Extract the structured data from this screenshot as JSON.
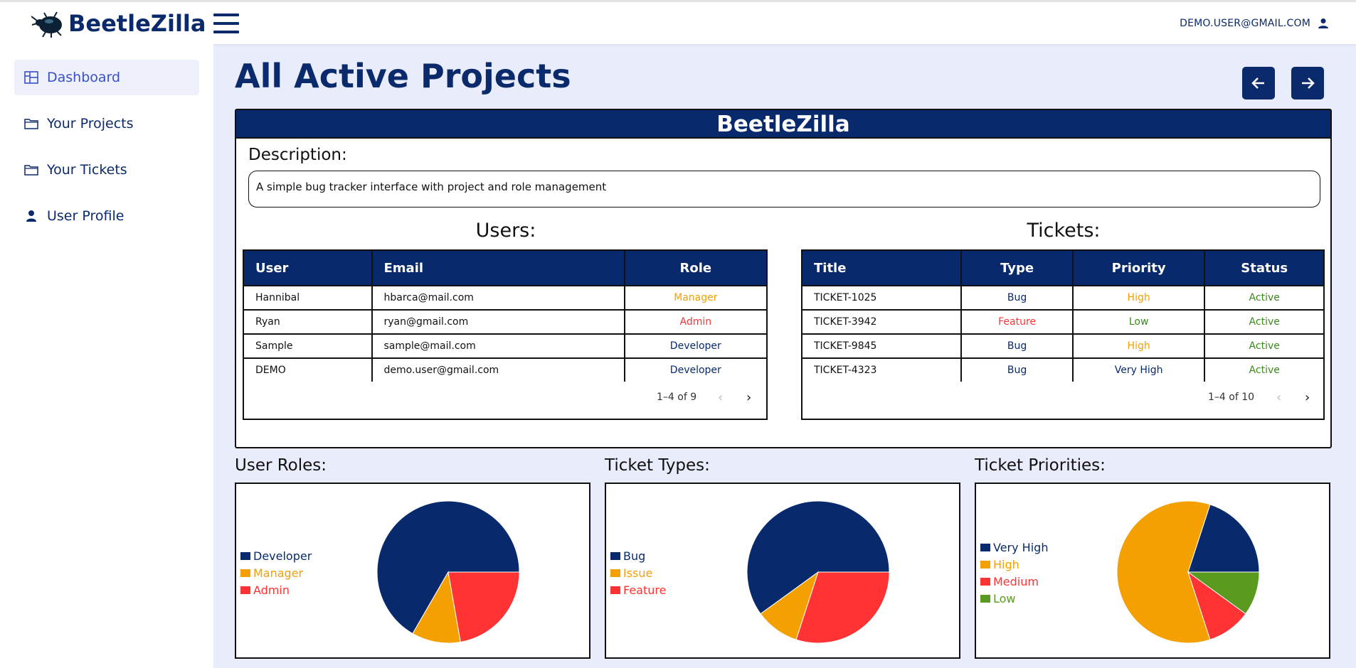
{
  "app": {
    "name": "BeetleZilla",
    "account_email": "DEMO.USER@GMAIL.COM"
  },
  "colors": {
    "navy": "#082a6d",
    "orange": "#f4a000",
    "red": "#ff3333",
    "green": "#5a9a1e"
  },
  "sidebar": {
    "items": [
      {
        "label": "Dashboard",
        "icon": "dashboard-icon",
        "active": true
      },
      {
        "label": "Your Projects",
        "icon": "folder-icon"
      },
      {
        "label": "Your Tickets",
        "icon": "folder-icon"
      },
      {
        "label": "User Profile",
        "icon": "person-icon"
      }
    ]
  },
  "main": {
    "title": "All Active Projects",
    "nav": {
      "prev": "arrow-left-icon",
      "next": "arrow-right-icon"
    }
  },
  "project": {
    "name": "BeetleZilla",
    "description_label": "Description:",
    "description": "A simple bug tracker interface with project and role management",
    "users_title": "Users:",
    "tickets_title": "Tickets:",
    "users": {
      "headers": [
        "User",
        "Email",
        "Role"
      ],
      "rows": [
        {
          "user": "Hannibal",
          "email": "hbarca@mail.com",
          "role": "Manager"
        },
        {
          "user": "Ryan",
          "email": "ryan@gmail.com",
          "role": "Admin"
        },
        {
          "user": "Sample",
          "email": "sample@mail.com",
          "role": "Developer"
        },
        {
          "user": "DEMO",
          "email": "demo.user@gmail.com",
          "role": "Developer"
        }
      ],
      "pagination": "1–4 of 9"
    },
    "tickets": {
      "headers": [
        "Title",
        "Type",
        "Priority",
        "Status"
      ],
      "rows": [
        {
          "title": "TICKET-1025",
          "type": "Bug",
          "priority": "High",
          "status": "Active"
        },
        {
          "title": "TICKET-3942",
          "type": "Feature",
          "priority": "Low",
          "status": "Active"
        },
        {
          "title": "TICKET-9845",
          "type": "Bug",
          "priority": "High",
          "status": "Active"
        },
        {
          "title": "TICKET-4323",
          "type": "Bug",
          "priority": "Very High",
          "status": "Active"
        }
      ],
      "pagination": "1–4 of 10"
    }
  },
  "charts": {
    "roles_title": "User Roles:",
    "types_title": "Ticket Types:",
    "priorities_title": "Ticket Priorities:"
  },
  "chart_data": [
    {
      "type": "pie",
      "title": "User Roles:",
      "categories": [
        "Developer",
        "Manager",
        "Admin"
      ],
      "values": [
        6,
        1,
        2
      ],
      "colors": [
        "#082a6d",
        "#f4a000",
        "#ff3333"
      ]
    },
    {
      "type": "pie",
      "title": "Ticket Types:",
      "categories": [
        "Bug",
        "Issue",
        "Feature"
      ],
      "values": [
        6,
        1,
        3
      ],
      "colors": [
        "#082a6d",
        "#f4a000",
        "#ff3333"
      ]
    },
    {
      "type": "pie",
      "title": "Ticket Priorities:",
      "categories": [
        "Very High",
        "High",
        "Medium",
        "Low"
      ],
      "values": [
        2,
        6,
        1,
        1
      ],
      "colors": [
        "#082a6d",
        "#f4a000",
        "#ff3333",
        "#5a9a1e"
      ]
    }
  ]
}
